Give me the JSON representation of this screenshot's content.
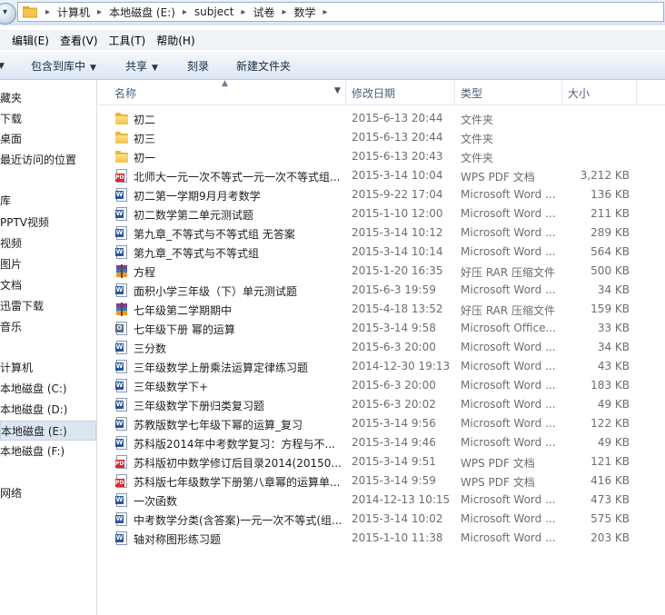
{
  "address": {
    "crumbs": [
      "计算机",
      "本地磁盘 (E:)",
      "subject",
      "试卷",
      "数学"
    ]
  },
  "menu": [
    "编辑(E)",
    "查看(V)",
    "工具(T)",
    "帮助(H)"
  ],
  "toolbar": {
    "include_library": "包含到库中",
    "share": "共享",
    "burn": "刻录",
    "new_folder": "新建文件夹"
  },
  "nav": {
    "items": [
      {
        "label": "藏夹"
      },
      {
        "label": "下载"
      },
      {
        "label": "桌面"
      },
      {
        "label": "最近访问的位置"
      },
      {
        "label": "库"
      },
      {
        "label": "PPTV视频"
      },
      {
        "label": "视频"
      },
      {
        "label": "图片"
      },
      {
        "label": "文档"
      },
      {
        "label": "迅雷下载"
      },
      {
        "label": "音乐"
      },
      {
        "label": "计算机"
      },
      {
        "label": "本地磁盘 (C:)"
      },
      {
        "label": "本地磁盘 (D:)"
      },
      {
        "label": "本地磁盘 (E:)"
      },
      {
        "label": "本地磁盘 (F:)"
      },
      {
        "label": "网络"
      }
    ]
  },
  "columns": {
    "name": "名称",
    "date": "修改日期",
    "type": "类型",
    "size": "大小"
  },
  "files": [
    {
      "icon": "folder-icon",
      "name": "初二",
      "date": "2015-6-13 20:44",
      "type": "文件夹",
      "size": ""
    },
    {
      "icon": "folder-icon",
      "name": "初三",
      "date": "2015-6-13 20:44",
      "type": "文件夹",
      "size": ""
    },
    {
      "icon": "folder-icon",
      "name": "初一",
      "date": "2015-6-13 20:43",
      "type": "文件夹",
      "size": ""
    },
    {
      "icon": "pdf-file-icon",
      "name": "北师大一元一次不等式一元一次不等式组...",
      "date": "2015-3-14 10:04",
      "type": "WPS PDF 文档",
      "size": "3,212 KB"
    },
    {
      "icon": "word-file-icon",
      "name": "初二第一学期9月月考数学",
      "date": "2015-9-22 17:04",
      "type": "Microsoft Word ...",
      "size": "136 KB"
    },
    {
      "icon": "word-file-icon",
      "name": "初二数学第二单元测试题",
      "date": "2015-1-10 12:00",
      "type": "Microsoft Word ...",
      "size": "211 KB"
    },
    {
      "icon": "word-file-icon",
      "name": "第九章_不等式与不等式组 无答案",
      "date": "2015-3-14 10:12",
      "type": "Microsoft Word ...",
      "size": "289 KB"
    },
    {
      "icon": "word-file-icon",
      "name": "第九章_不等式与不等式组",
      "date": "2015-3-14 10:14",
      "type": "Microsoft Word ...",
      "size": "564 KB"
    },
    {
      "icon": "rar-archive-icon",
      "name": "方程",
      "date": "2015-1-20 16:35",
      "type": "好压 RAR 压缩文件",
      "size": "500 KB"
    },
    {
      "icon": "word-file-icon",
      "name": "面积小学三年级（下）单元测试题",
      "date": "2015-6-3 19:59",
      "type": "Microsoft Word ...",
      "size": "34 KB"
    },
    {
      "icon": "rar-archive-icon",
      "name": "七年级第二学期期中",
      "date": "2015-4-18 13:52",
      "type": "好压 RAR 压缩文件",
      "size": "159 KB"
    },
    {
      "icon": "office-file-icon",
      "name": "七年级下册 幂的运算",
      "date": "2015-3-14 9:58",
      "type": "Microsoft Office...",
      "size": "33 KB"
    },
    {
      "icon": "word-file-icon",
      "name": "三分数",
      "date": "2015-6-3 20:00",
      "type": "Microsoft Word ...",
      "size": "34 KB"
    },
    {
      "icon": "word-file-icon",
      "name": "三年级数学上册乘法运算定律练习题",
      "date": "2014-12-30 19:13",
      "type": "Microsoft Word ...",
      "size": "43 KB"
    },
    {
      "icon": "word-file-icon",
      "name": "三年级数学下+",
      "date": "2015-6-3 20:00",
      "type": "Microsoft Word ...",
      "size": "183 KB"
    },
    {
      "icon": "word-file-icon",
      "name": "三年级数学下册归类复习题",
      "date": "2015-6-3 20:02",
      "type": "Microsoft Word ...",
      "size": "49 KB"
    },
    {
      "icon": "word-file-icon",
      "name": "苏教版数学七年级下幂的运算_复习",
      "date": "2015-3-14 9:56",
      "type": "Microsoft Word ...",
      "size": "122 KB"
    },
    {
      "icon": "word-file-icon",
      "name": "苏科版2014年中考数学复习：方程与不...",
      "date": "2015-3-14 9:46",
      "type": "Microsoft Word ...",
      "size": "49 KB"
    },
    {
      "icon": "pdf-file-icon",
      "name": "苏科版初中数学修订后目录2014(20150...",
      "date": "2015-3-14 9:51",
      "type": "WPS PDF 文档",
      "size": "121 KB"
    },
    {
      "icon": "pdf-file-icon",
      "name": "苏科版七年级数学下册第八章幂的运算单...",
      "date": "2015-3-14 9:59",
      "type": "WPS PDF 文档",
      "size": "416 KB"
    },
    {
      "icon": "word-file-icon",
      "name": "一次函数",
      "date": "2014-12-13 10:15",
      "type": "Microsoft Word ...",
      "size": "473 KB"
    },
    {
      "icon": "word-file-icon",
      "name": "中考数学分类(含答案)一元一次不等式(组...",
      "date": "2015-3-14 10:02",
      "type": "Microsoft Word ...",
      "size": "575 KB"
    },
    {
      "icon": "word-file-icon",
      "name": "轴对称图形练习题",
      "date": "2015-1-10 11:38",
      "type": "Microsoft Word ...",
      "size": "203 KB"
    }
  ]
}
